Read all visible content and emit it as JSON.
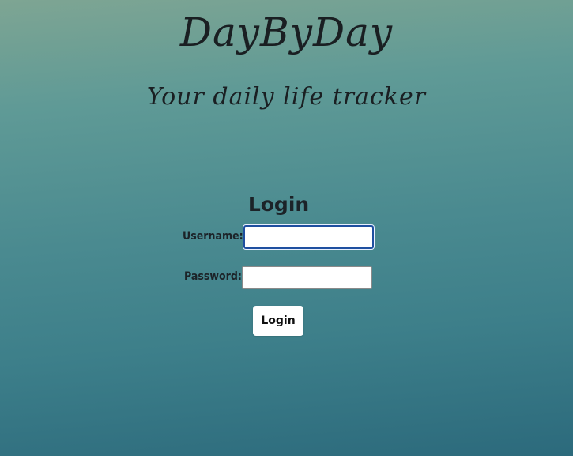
{
  "header": {
    "logo_text": "DayByDay",
    "tagline": "Your daily life tracker"
  },
  "login_form": {
    "title": "Login",
    "username_label": "Username:",
    "username_value": "",
    "password_label": "Password:",
    "password_value": "",
    "submit_label": "Login"
  },
  "colors": {
    "background_top": "#7ea593",
    "background_bottom": "#2c6a7c",
    "focus_border": "#1f4fa0",
    "text": "#1c2328"
  }
}
